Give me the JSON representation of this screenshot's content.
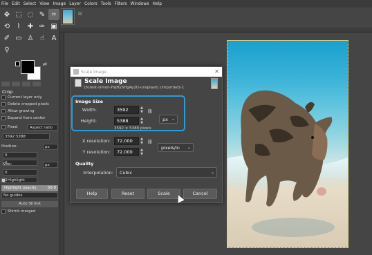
{
  "menubar": [
    "File",
    "Edit",
    "Select",
    "View",
    "Image",
    "Layer",
    "Colors",
    "Tools",
    "Filters",
    "Windows",
    "Help"
  ],
  "tool_options": {
    "title": "Crop",
    "current_layer_only": "Current layer only",
    "delete_cropped": "Delete cropped pixels",
    "allow_growing": "Allow growing",
    "expand_center": "Expand from center",
    "fixed_label": "Fixed",
    "aspect_ratio": "Aspect ratio",
    "ratio_value": "3592:5388",
    "position_label": "Position:",
    "position_unit": "px",
    "position_x": "0",
    "position_y": "0",
    "size_label": "Size:",
    "size_unit": "px",
    "size_x": "0",
    "size_y": "0",
    "highlight": "Highlight",
    "highlight_opacity": "Highlight opacity",
    "highlight_opacity_value": "50.0",
    "guides": "No guides",
    "auto_shrink": "Auto Shrink",
    "shrink_merged": "Shrink merged"
  },
  "dialog": {
    "window_title": "Scale Image",
    "heading": "Scale Image",
    "subtitle": "[forest-simon-HqHySHgAy2U-unsplash] (imported)-1",
    "image_size_label": "Image Size",
    "width_label": "Width:",
    "width_value": "3592",
    "height_label": "Height:",
    "height_value": "5388",
    "size_unit": "px",
    "pixels_note": "3592 × 5388 pixels",
    "xres_label": "X resolution:",
    "xres_value": "72.000",
    "yres_label": "Y resolution:",
    "yres_value": "72.000",
    "res_unit": "pixels/in",
    "quality_label": "Quality",
    "interp_label": "Interpolation:",
    "interp_value": "Cubic",
    "buttons": {
      "help": "Help",
      "reset": "Reset",
      "scale": "Scale",
      "cancel": "Cancel"
    }
  }
}
